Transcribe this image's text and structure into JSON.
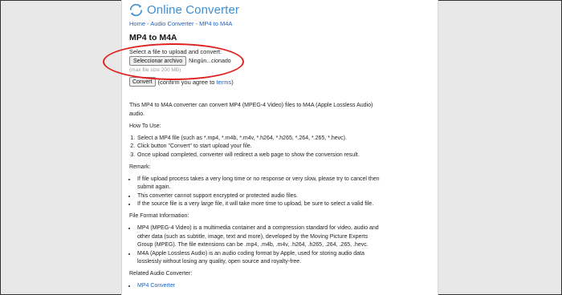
{
  "header": {
    "logo_text": "Online Converter"
  },
  "breadcrumb": {
    "home": "Home",
    "sep1": " - ",
    "audio": "Audio Converter",
    "sep2": " - ",
    "current": "MP4 to M4A"
  },
  "title": "MP4 to M4A",
  "upload": {
    "prompt": "Select a file to upload and convert:",
    "file_button": "Seleccionar archivo",
    "file_name": "Ningún...cionado",
    "max_size": "(max file size 200 MB)",
    "convert_button": "Convert",
    "agree_prefix": "(confirm you agree to ",
    "terms_link": "terms",
    "agree_suffix": ")"
  },
  "description": "This MP4 to M4A converter can convert MP4 (MPEG-4 Video) files to M4A (Apple Lossless Audio) audio.",
  "how_to": {
    "heading": "How To Use:",
    "steps": [
      "Select a MP4 file (such as *.mp4, *.m4b, *.m4v, *.h264, *.h265, *.264, *.265, *.hevc).",
      "Click button \"Convert\" to start upload your file.",
      "Once upload completed, converter will redirect a web page to show the conversion result."
    ]
  },
  "remark": {
    "heading": "Remark:",
    "items": [
      "If file upload process takes a very long time or no response or very slow, please try to cancel then submit again.",
      "This converter cannot support encrypted or protected audio files.",
      "If the source file is a very large file, it will take more time to upload, be sure to select a valid file."
    ]
  },
  "format_info": {
    "heading": "File Format Information:",
    "items": [
      "MP4 (MPEG-4 Video) is a multimedia container and a compression standard for video, audio and other data (such as subtitle, image, text and more), developed by the Moving Picture Experts Group (MPEG). The file extensions can be .mp4, .m4b, .m4v, .h264, .h265, .264, .265, .hevc.",
      "M4A (Apple Lossless Audio) is an audio coding format by Apple, used for storing audio data losslessly without losing any quality, open source and royalty-free."
    ]
  },
  "related": {
    "heading": "Related Audio Converter:",
    "links": [
      "MP4 Converter"
    ]
  },
  "colors": {
    "accent": "#3f8fd2",
    "link": "#1a63c7",
    "highlight": "#e02020"
  }
}
